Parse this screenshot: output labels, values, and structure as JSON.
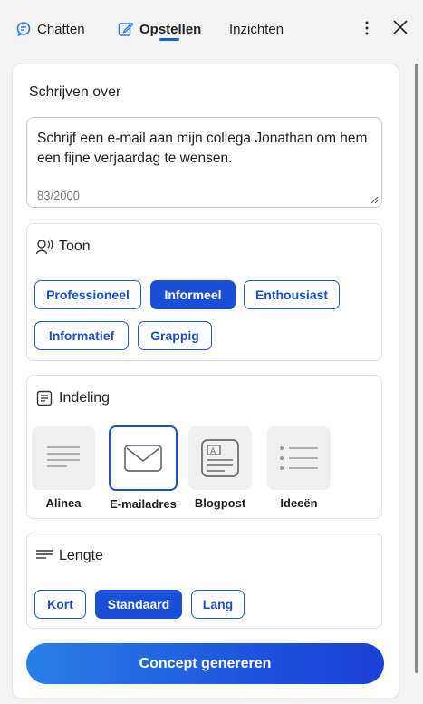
{
  "tabs": [
    {
      "label": "Chatten",
      "icon": "chat-bubble-icon"
    },
    {
      "label": "Opstellen",
      "icon": "compose-icon",
      "active": true
    },
    {
      "label": "Inzichten"
    }
  ],
  "compose": {
    "section_title": "Schrijven over",
    "prompt_text": "Schrijf een e-mail aan mijn collega Jonathan om hem een fijne verjaardag te wensen.",
    "char_count": "83/2000"
  },
  "tone": {
    "title": "Toon",
    "options": [
      "Professioneel",
      "Informeel",
      "Enthousiast",
      "Informatief",
      "Grappig"
    ],
    "selected": "Informeel"
  },
  "format": {
    "title": "Indeling",
    "options": [
      "Alinea",
      "E-mailadres",
      "Blogpost",
      "Ideeën"
    ],
    "selected": "E-mailadres"
  },
  "length": {
    "title": "Lengte",
    "options": [
      "Kort",
      "Standaard",
      "Lang"
    ],
    "selected": "Standaard"
  },
  "generate_label": "Concept genereren",
  "colors": {
    "accent": "#1a4fd8",
    "accent_text": "#1d4fc4",
    "background": "#f3f3f3"
  }
}
